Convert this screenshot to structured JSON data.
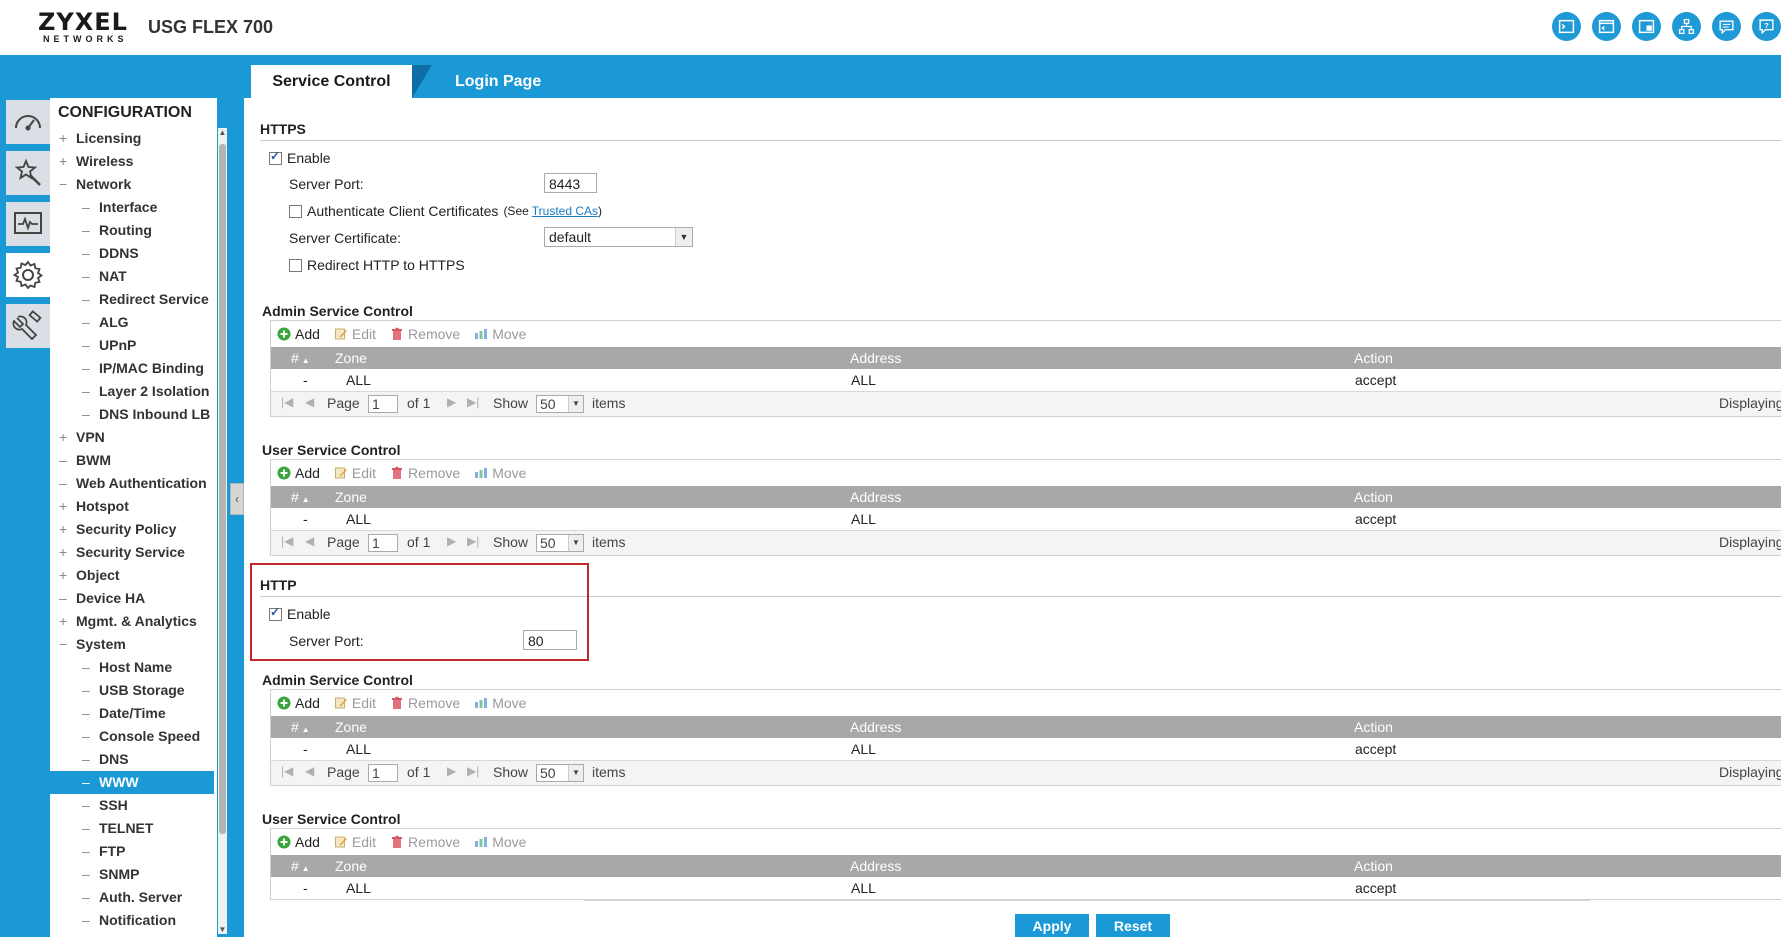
{
  "header": {
    "logo_main": "ZYXEL",
    "logo_sub": "NETWORKS",
    "model": "USG FLEX 700",
    "icons": [
      "console-icon",
      "cli-icon",
      "window-icon",
      "network-icon",
      "chat-icon",
      "help-icon"
    ]
  },
  "tabs": [
    {
      "label": "Service Control",
      "active": true
    },
    {
      "label": "Login Page",
      "active": false
    }
  ],
  "rail": [
    "dashboard-icon",
    "wizard-icon",
    "monitor-icon",
    "configuration-icon",
    "maintenance-icon"
  ],
  "nav": {
    "title": "CONFIGURATION",
    "items": [
      {
        "pm": "+",
        "label": "Licensing",
        "sub": false
      },
      {
        "pm": "+",
        "label": "Wireless",
        "sub": false
      },
      {
        "pm": "−",
        "label": "Network",
        "sub": false
      },
      {
        "pm": "–",
        "label": "Interface",
        "sub": true
      },
      {
        "pm": "–",
        "label": "Routing",
        "sub": true
      },
      {
        "pm": "–",
        "label": "DDNS",
        "sub": true
      },
      {
        "pm": "–",
        "label": "NAT",
        "sub": true
      },
      {
        "pm": "–",
        "label": "Redirect Service",
        "sub": true
      },
      {
        "pm": "–",
        "label": "ALG",
        "sub": true
      },
      {
        "pm": "–",
        "label": "UPnP",
        "sub": true
      },
      {
        "pm": "–",
        "label": "IP/MAC Binding",
        "sub": true
      },
      {
        "pm": "–",
        "label": "Layer 2 Isolation",
        "sub": true
      },
      {
        "pm": "–",
        "label": "DNS Inbound LB",
        "sub": true
      },
      {
        "pm": "+",
        "label": "VPN",
        "sub": false
      },
      {
        "pm": "–",
        "label": "BWM",
        "sub": false
      },
      {
        "pm": "–",
        "label": "Web Authentication",
        "sub": false
      },
      {
        "pm": "+",
        "label": "Hotspot",
        "sub": false
      },
      {
        "pm": "+",
        "label": "Security Policy",
        "sub": false
      },
      {
        "pm": "+",
        "label": "Security Service",
        "sub": false
      },
      {
        "pm": "+",
        "label": "Object",
        "sub": false
      },
      {
        "pm": "–",
        "label": "Device HA",
        "sub": false
      },
      {
        "pm": "+",
        "label": "Mgmt. & Analytics",
        "sub": false
      },
      {
        "pm": "−",
        "label": "System",
        "sub": false
      },
      {
        "pm": "–",
        "label": "Host Name",
        "sub": true
      },
      {
        "pm": "–",
        "label": "USB Storage",
        "sub": true
      },
      {
        "pm": "–",
        "label": "Date/Time",
        "sub": true
      },
      {
        "pm": "–",
        "label": "Console Speed",
        "sub": true
      },
      {
        "pm": "–",
        "label": "DNS",
        "sub": true
      },
      {
        "pm": "–",
        "label": "WWW",
        "sub": true,
        "selected": true
      },
      {
        "pm": "–",
        "label": "SSH",
        "sub": true
      },
      {
        "pm": "–",
        "label": "TELNET",
        "sub": true
      },
      {
        "pm": "–",
        "label": "FTP",
        "sub": true
      },
      {
        "pm": "–",
        "label": "SNMP",
        "sub": true
      },
      {
        "pm": "–",
        "label": "Auth. Server",
        "sub": true
      },
      {
        "pm": "–",
        "label": "Notification",
        "sub": true
      }
    ]
  },
  "https": {
    "title": "HTTPS",
    "enable_label": "Enable",
    "port_label": "Server Port:",
    "port_value": "8443",
    "auth_label": "Authenticate Client Certificates",
    "see_label": "(See",
    "trusted_link": "Trusted CAs",
    "see_close": ")",
    "cert_label": "Server Certificate:",
    "cert_value": "default",
    "redirect_label": "Redirect HTTP to HTTPS"
  },
  "http": {
    "title": "HTTP",
    "enable_label": "Enable",
    "port_label": "Server Port:",
    "port_value": "80"
  },
  "grid": {
    "admin_title": "Admin Service Control",
    "user_title": "User Service Control",
    "add": "Add",
    "edit": "Edit",
    "remove": "Remove",
    "move": "Move",
    "col_num": "#",
    "col_zone": "Zone",
    "col_address": "Address",
    "col_action": "Action",
    "row_num": "-",
    "row_zone": "ALL",
    "row_address": "ALL",
    "row_action": "accept",
    "page_label": "Page",
    "page_value": "1",
    "of_label": "of 1",
    "show_label": "Show",
    "show_value": "50",
    "items_label": "items",
    "displaying": "Displaying"
  },
  "buttons": {
    "apply": "Apply",
    "reset": "Reset"
  }
}
